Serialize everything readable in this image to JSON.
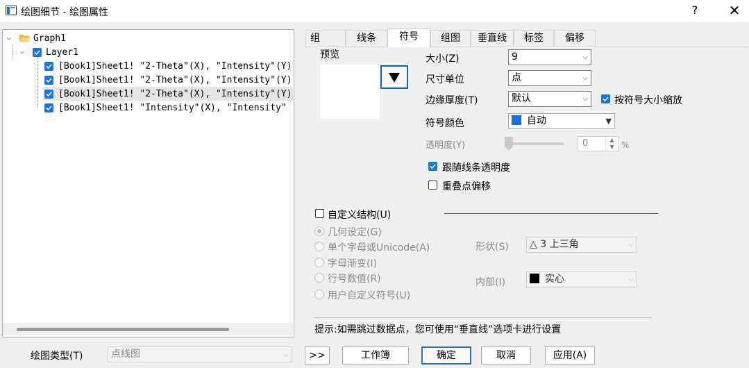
{
  "window": {
    "title": "绘图细节 - 绘图属性",
    "help": "?",
    "close": "✕"
  },
  "tree": {
    "root": "Graph1",
    "layer": "Layer1",
    "items": [
      "[Book1]Sheet1! \"2-Theta\"(X), \"Intensity\"(Y)",
      "[Book1]Sheet1! \"2-Theta\"(X), \"Intensity\"(Y)",
      "[Book1]Sheet1! \"2-Theta\"(X), \"Intensity\"(Y)",
      "[Book1]Sheet1! \"Intensity\"(X), \"Intensity\""
    ],
    "selected_index": 2
  },
  "tabs": [
    "组",
    "线条",
    "符号",
    "组图",
    "垂直线",
    "标签",
    "偏移"
  ],
  "active_tab": "符号",
  "symbol": {
    "preview_label": "预览",
    "size_label": "大小(Z)",
    "size_value": "9",
    "unit_label": "尺寸单位",
    "unit_value": "点",
    "edge_label": "边缘厚度(T)",
    "edge_value": "默认",
    "scale_label": "按符号大小缩放",
    "color_label": "符号颜色",
    "color_value": "自动",
    "color_swatch": "#1a6fe0",
    "transparency_label": "透明度(Y)",
    "transparency_value": "0",
    "transparency_unit": "%",
    "follow_line_label": "跟随线条透明度",
    "overlap_label": "重叠点偏移",
    "custom_label": "自定义结构(U)",
    "radio_options": [
      "几何设定(G)",
      "单个字母或Unicode(A)",
      "字母渐变(I)",
      "行号数值(R)",
      "用户自定义符号(U)"
    ],
    "shape_label": "形状(S)",
    "shape_value": "△ 3 上三角",
    "interior_label": "内部(I)",
    "interior_value": "实心",
    "hint": "提示:如需跳过数据点，您可使用“垂直线”选项卡进行设置"
  },
  "footer": {
    "plot_type_label": "绘图类型(T)",
    "plot_type_value": "点线图",
    "expand": ">>",
    "workbook": "工作簿",
    "ok": "确定",
    "cancel": "取消",
    "apply": "应用(A)"
  }
}
